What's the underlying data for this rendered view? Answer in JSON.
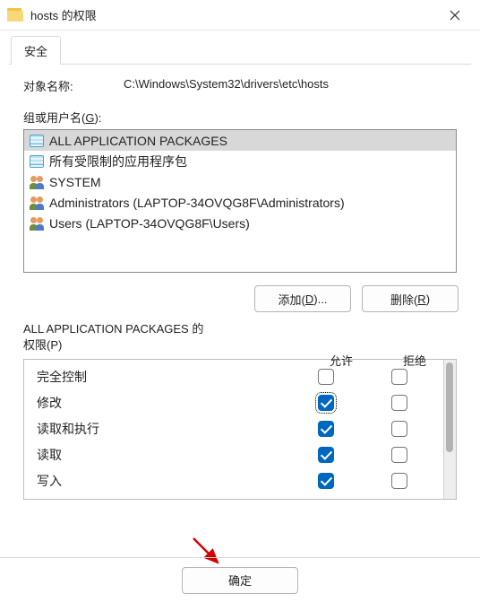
{
  "window": {
    "title": "hosts 的权限"
  },
  "tabs": {
    "security": "安全"
  },
  "object": {
    "label": "对象名称:",
    "value": "C:\\Windows\\System32\\drivers\\etc\\hosts"
  },
  "groupLabel": {
    "pre": "组或用户名(",
    "u": "G",
    "post": "):"
  },
  "users": [
    {
      "name": "ALL APPLICATION PACKAGES",
      "iconType": "app",
      "selected": true
    },
    {
      "name": "所有受限制的应用程序包",
      "iconType": "app",
      "selected": false
    },
    {
      "name": "SYSTEM",
      "iconType": "users",
      "selected": false
    },
    {
      "name": "Administrators (LAPTOP-34OVQG8F\\Administrators)",
      "iconType": "users",
      "selected": false
    },
    {
      "name": "Users (LAPTOP-34OVQG8F\\Users)",
      "iconType": "users",
      "selected": false
    }
  ],
  "buttons": {
    "add": {
      "pre": "添加(",
      "u": "D",
      "post": ")..."
    },
    "remove": {
      "pre": "删除(",
      "u": "R",
      "post": ")"
    },
    "ok": "确定"
  },
  "permHeader": {
    "titleLine1": "ALL APPLICATION PACKAGES 的",
    "titleLine2pre": "权限(",
    "titleLine2u": "P",
    "titleLine2post": ")",
    "allow": "允许",
    "deny": "拒绝"
  },
  "perms": [
    {
      "name": "完全控制",
      "allow": false,
      "deny": false,
      "focused": false
    },
    {
      "name": "修改",
      "allow": true,
      "deny": false,
      "focused": true
    },
    {
      "name": "读取和执行",
      "allow": true,
      "deny": false,
      "focused": false
    },
    {
      "name": "读取",
      "allow": true,
      "deny": false,
      "focused": false
    },
    {
      "name": "写入",
      "allow": true,
      "deny": false,
      "focused": false
    }
  ]
}
